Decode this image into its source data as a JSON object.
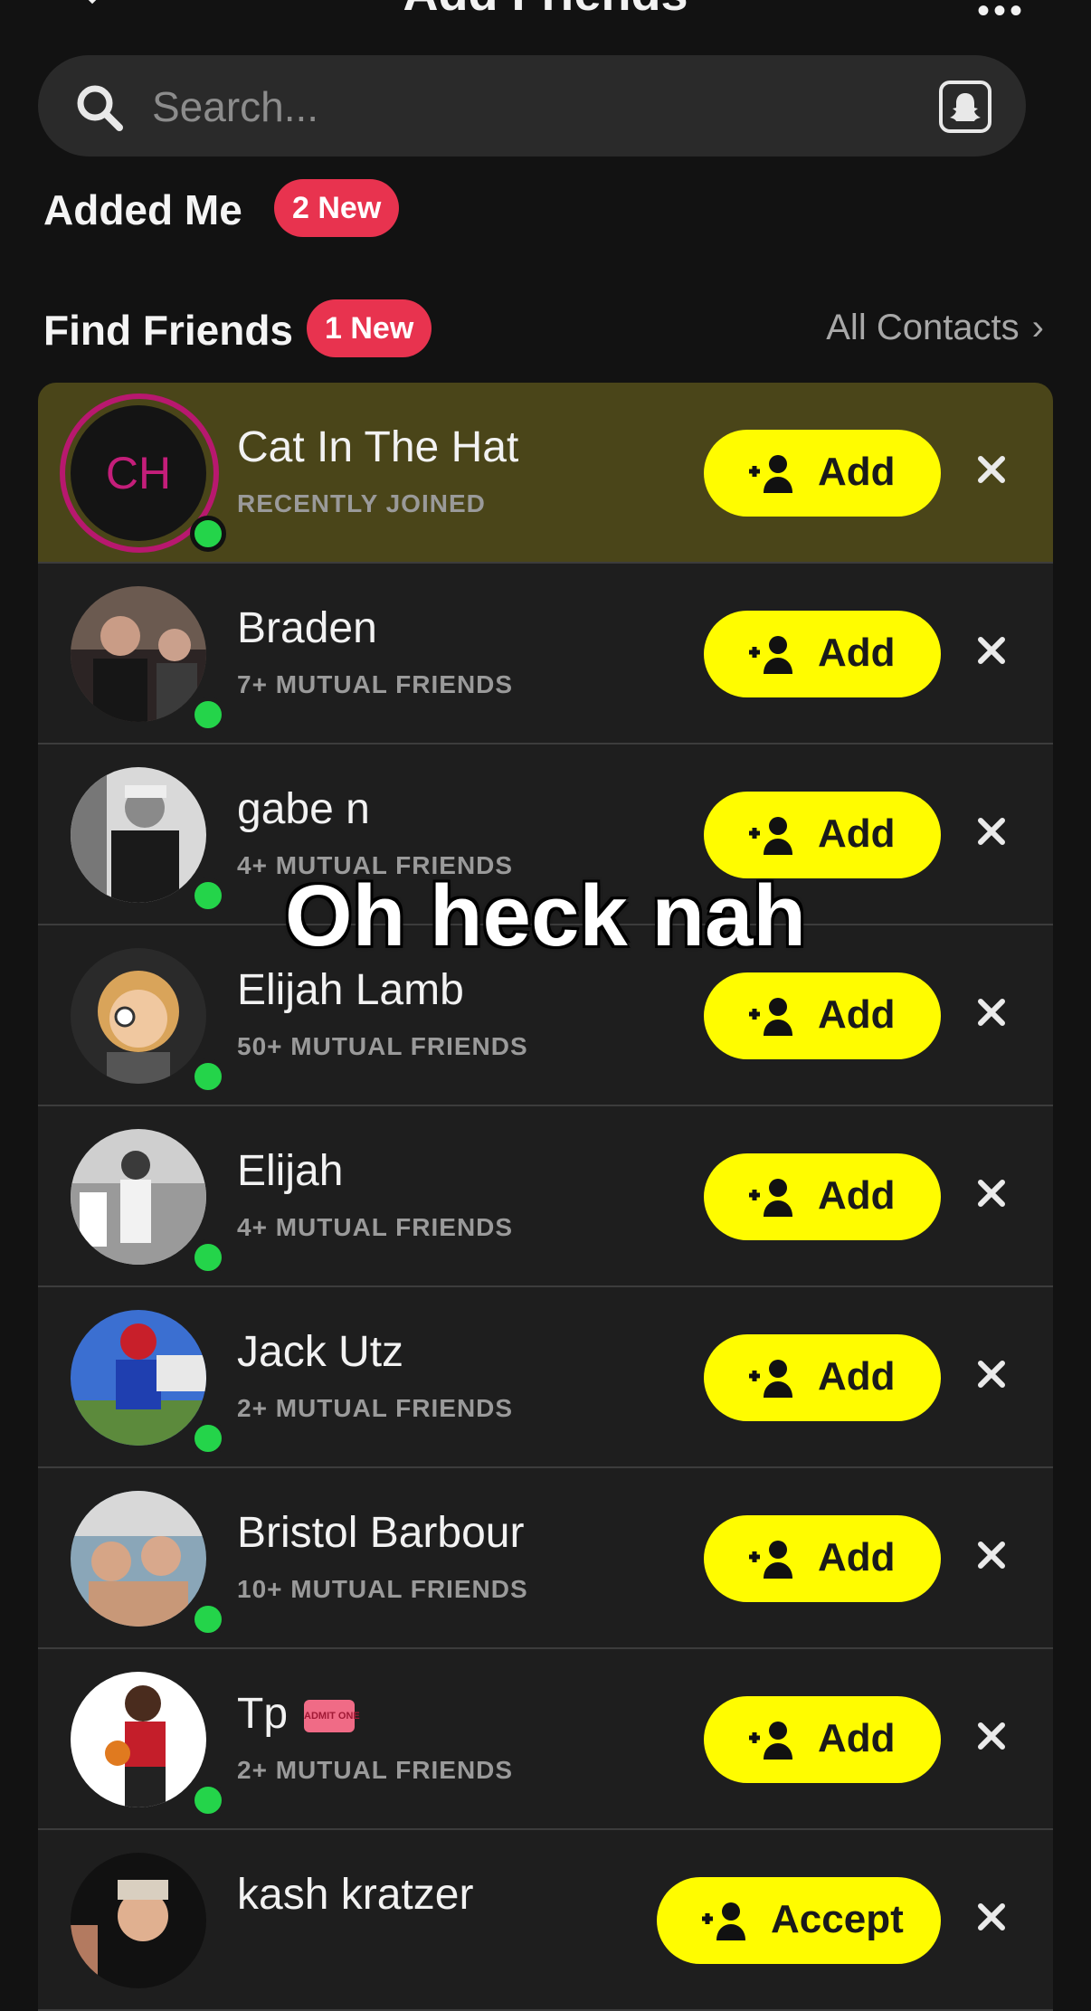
{
  "header": {
    "title": "Add Friends"
  },
  "search": {
    "placeholder": "Search..."
  },
  "added_me": {
    "title": "Added Me",
    "badge": "2 New"
  },
  "find_friends": {
    "title": "Find Friends",
    "badge": "1 New",
    "all_contacts": "All Contacts"
  },
  "rows": [
    {
      "name": "Cat In The Hat",
      "initials": "CH",
      "sub": "RECENTLY JOINED",
      "button": "Add"
    },
    {
      "name": "Braden",
      "sub": "7+ MUTUAL FRIENDS",
      "button": "Add"
    },
    {
      "name": "gabe n",
      "sub": "4+ MUTUAL FRIENDS",
      "button": "Add"
    },
    {
      "name": "Elijah Lamb",
      "sub": "50+ MUTUAL FRIENDS",
      "button": "Add"
    },
    {
      "name": "Elijah",
      "sub": "4+ MUTUAL FRIENDS",
      "button": "Add"
    },
    {
      "name": "Jack Utz",
      "sub": "2+ MUTUAL FRIENDS",
      "button": "Add"
    },
    {
      "name": "Bristol Barbour",
      "sub": "10+ MUTUAL FRIENDS",
      "button": "Add"
    },
    {
      "name": "Tp",
      "sub": "2+ MUTUAL FRIENDS",
      "button": "Add",
      "ticket": "ADMIT ONE"
    },
    {
      "name": "kash kratzer",
      "sub": "",
      "button": "Accept"
    }
  ],
  "overlay_caption": "Oh heck nah",
  "colors": {
    "accent_yellow": "#fffc00",
    "badge_red": "#e8334f",
    "online_green": "#24d44a",
    "highlight_row": "#4a4519",
    "ring_magenta": "#b8186f"
  },
  "icons": [
    "back-chevron-icon",
    "more-dots-icon",
    "search-icon",
    "snapcode-icon",
    "add-friend-icon",
    "close-icon",
    "chevron-right-icon",
    "ticket-icon"
  ]
}
